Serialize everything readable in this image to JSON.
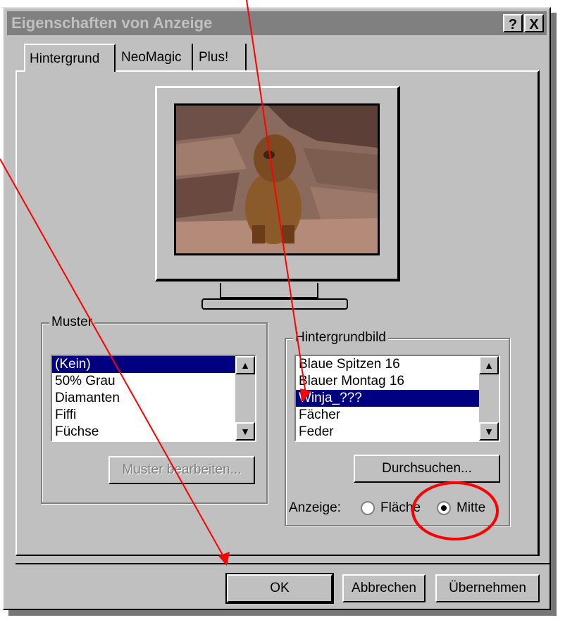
{
  "window": {
    "title": "Eigenschaften von Anzeige",
    "help_label": "?",
    "close_label": "X"
  },
  "tabs": [
    {
      "label": "Hintergrund"
    },
    {
      "label": "NeoMagic"
    },
    {
      "label": "Plus!"
    }
  ],
  "muster": {
    "group_label": "Muster",
    "items": [
      "(Kein)",
      "50% Grau",
      "Diamanten",
      "Fiffi",
      "Füchse"
    ],
    "selected_index": 0,
    "edit_button": "Muster bearbeiten..."
  },
  "hintergrundbild": {
    "group_label": "Hintergrundbild",
    "items": [
      "Blaue Spitzen 16",
      "Blauer Montag 16",
      "Winja_???",
      "Fächer",
      "Feder"
    ],
    "selected_index": 2,
    "browse_button": "Durchsuchen...",
    "display_label": "Anzeige:",
    "options": [
      {
        "label": "Fläche",
        "selected": false
      },
      {
        "label": "Mitte",
        "selected": true
      }
    ]
  },
  "buttons": {
    "ok": "OK",
    "cancel": "Abbrechen",
    "apply": "Übernehmen"
  },
  "colors": {
    "dialog_bg": "#c0c0c0",
    "selection": "#000080",
    "annotation": "#ff0000"
  },
  "icons": {
    "scroll_up": "up-arrow-icon",
    "scroll_down": "down-arrow-icon"
  }
}
